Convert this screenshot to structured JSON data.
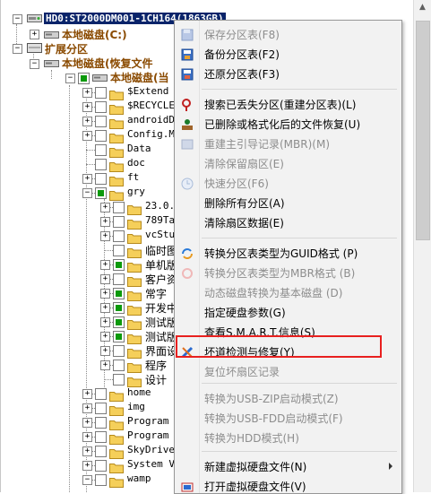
{
  "tree": {
    "disk_label": "HD0:ST2000DM001-1CH164(1863GB)",
    "partition_c": "本地磁盘(C:)",
    "extended": "扩展分区",
    "local_disk_recovery": "本地磁盘(恢复文件",
    "local_disk_current": "本地磁盘(当",
    "items": [
      "$Extend",
      "$RECYCLE.",
      "androidDe",
      "Config.Ms",
      "Data",
      "doc",
      "ft",
      "gry",
      "23.0.2",
      "789Tad",
      "vcStuc",
      "临时图",
      "单机版",
      "客户资",
      "常字",
      "开发中",
      "测试版",
      "测试版",
      "界面设",
      "程序",
      "设计",
      "home",
      "img",
      "Program F",
      "Program F",
      "SkyDrive",
      "System Vo",
      "wamp"
    ]
  },
  "menu": {
    "items": [
      {
        "label": "保存分区表(F8)",
        "icon": "save-icon",
        "disabled": true
      },
      {
        "label": "备份分区表(F2)",
        "icon": "backup-icon",
        "disabled": false
      },
      {
        "label": "还原分区表(F3)",
        "icon": "restore-icon",
        "disabled": false
      },
      {
        "label": "搜索已丢失分区(重建分区表)(L)",
        "icon": "search-icon",
        "disabled": false
      },
      {
        "label": "已删除或格式化后的文件恢复(U)",
        "icon": "recover-icon",
        "disabled": false
      },
      {
        "label": "重建主引导记录(MBR)(M)",
        "icon": "rebuild-icon",
        "disabled": true
      },
      {
        "label": "清除保留扇区(E)",
        "icon": "",
        "disabled": true
      },
      {
        "label": "快速分区(F6)",
        "icon": "clock-icon",
        "disabled": true
      },
      {
        "label": "删除所有分区(A)",
        "icon": "",
        "disabled": false
      },
      {
        "label": "清除扇区数据(E)",
        "icon": "",
        "disabled": false
      },
      {
        "label": "转换分区表类型为GUID格式 (P)",
        "icon": "convert-icon",
        "disabled": false
      },
      {
        "label": "转换分区表类型为MBR格式 (B)",
        "icon": "convert-gray-icon",
        "disabled": true
      },
      {
        "label": "动态磁盘转换为基本磁盘 (D)",
        "icon": "",
        "disabled": true
      },
      {
        "label": "指定硬盘参数(G)",
        "icon": "",
        "disabled": false
      },
      {
        "label": "查看S.M.A.R.T.信息(S)",
        "icon": "",
        "disabled": false
      },
      {
        "label": "坏道检测与修复(Y)",
        "icon": "tools-icon",
        "disabled": false
      },
      {
        "label": "复位坏扇区记录",
        "icon": "",
        "disabled": true
      },
      {
        "label": "转换为USB-ZIP启动模式(Z)",
        "icon": "",
        "disabled": true
      },
      {
        "label": "转换为USB-FDD启动模式(F)",
        "icon": "",
        "disabled": true
      },
      {
        "label": "转换为HDD模式(H)",
        "icon": "",
        "disabled": true
      },
      {
        "label": "新建虚拟硬盘文件(N)",
        "icon": "",
        "disabled": false
      },
      {
        "label": "打开虚拟硬盘文件(V)",
        "icon": "open-vdisk-icon",
        "disabled": false
      }
    ]
  },
  "colors": {
    "highlight_border": "#e8201f",
    "selection": "#0a246a",
    "checked": "#0c9a0c",
    "folder": "#f5cf5a",
    "partition_text": "#8a4a00"
  }
}
